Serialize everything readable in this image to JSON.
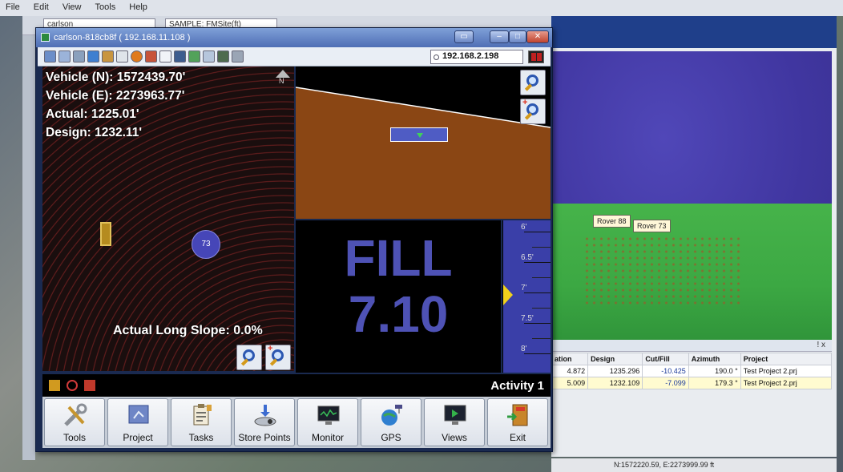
{
  "background_app": {
    "menu": [
      "File",
      "Edit",
      "View",
      "Tools",
      "Help"
    ],
    "toolbar_dropdown_1": "carlson",
    "toolbar_dropdown_2": "SAMPLE: FMSite(ft)",
    "map_labels": {
      "rover_88": "Rover 88",
      "rover_73": "Rover 73"
    },
    "table": {
      "columns": [
        "ation",
        "Design",
        "Cut/Fill",
        "Azimuth",
        "Project"
      ],
      "rows": [
        {
          "elevation": "4.872",
          "design": "1235.296",
          "cutfill": "-10.425",
          "azimuth": "190.0 °",
          "project": "Test Project 2.prj"
        },
        {
          "elevation": "5.009",
          "design": "1232.109",
          "cutfill": "-7.099",
          "azimuth": "179.3 °",
          "project": "Test Project 2.prj"
        }
      ]
    },
    "dock_pin": "ǃ x",
    "status_coords": "N:1572220.59, E:2273999.99 ft"
  },
  "window": {
    "title": "carlson-818cb8f ( 192.168.11.108 )",
    "ip_field": "192.168.2.198",
    "plan": {
      "vehicle_n": "Vehicle (N): 1572439.70'",
      "vehicle_e": "Vehicle (E): 2273963.77'",
      "actual": "Actual: 1225.01'",
      "design": "Design: 1232.11'",
      "north_label": "N",
      "rover_label": "73",
      "slope": "Actual Long Slope: 0.0%"
    },
    "fill": {
      "word": "FILL",
      "value": "7.10"
    },
    "scale_labels": [
      "6'",
      "6.5'",
      "7'",
      "7.5'",
      "8'"
    ],
    "status_activity": "Activity 1",
    "buttons": [
      "Tools",
      "Project",
      "Tasks",
      "Store Points",
      "Monitor",
      "GPS",
      "Views",
      "Exit"
    ],
    "colors": {
      "cut_fill_text": "#4e52b5",
      "indicator": "#f1d21c",
      "terrain": "#8a4614"
    }
  }
}
